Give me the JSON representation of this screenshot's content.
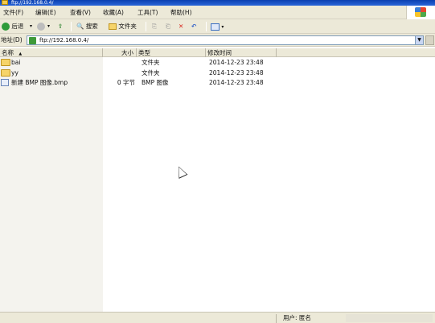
{
  "window": {
    "title": "ftp://192.168.0.4/"
  },
  "menubar": {
    "items": [
      "文件(F)",
      "编辑(E)",
      "查看(V)",
      "收藏(A)",
      "工具(T)",
      "帮助(H)"
    ]
  },
  "toolbar": {
    "back_label": "后退",
    "search_label": "搜索",
    "folders_label": "文件夹"
  },
  "addressbar": {
    "label": "地址(D)",
    "value": "ftp://192.168.0.4/"
  },
  "columns": [
    "名称",
    "大小",
    "类型",
    "修改时间"
  ],
  "files": [
    {
      "name": "bai",
      "size": "",
      "type": "文件夹",
      "modified": "2014-12-23 23:48",
      "icon": "folder-icon"
    },
    {
      "name": "yy",
      "size": "",
      "type": "文件夹",
      "modified": "2014-12-23 23:48",
      "icon": "folder-icon"
    },
    {
      "name": "新建 BMP 图像.bmp",
      "size": "0 字节",
      "type": "BMP 图像",
      "modified": "2014-12-23 23:48",
      "icon": "bmp-image-icon"
    }
  ],
  "statusbar": {
    "user_label": "用户: 匿名"
  }
}
